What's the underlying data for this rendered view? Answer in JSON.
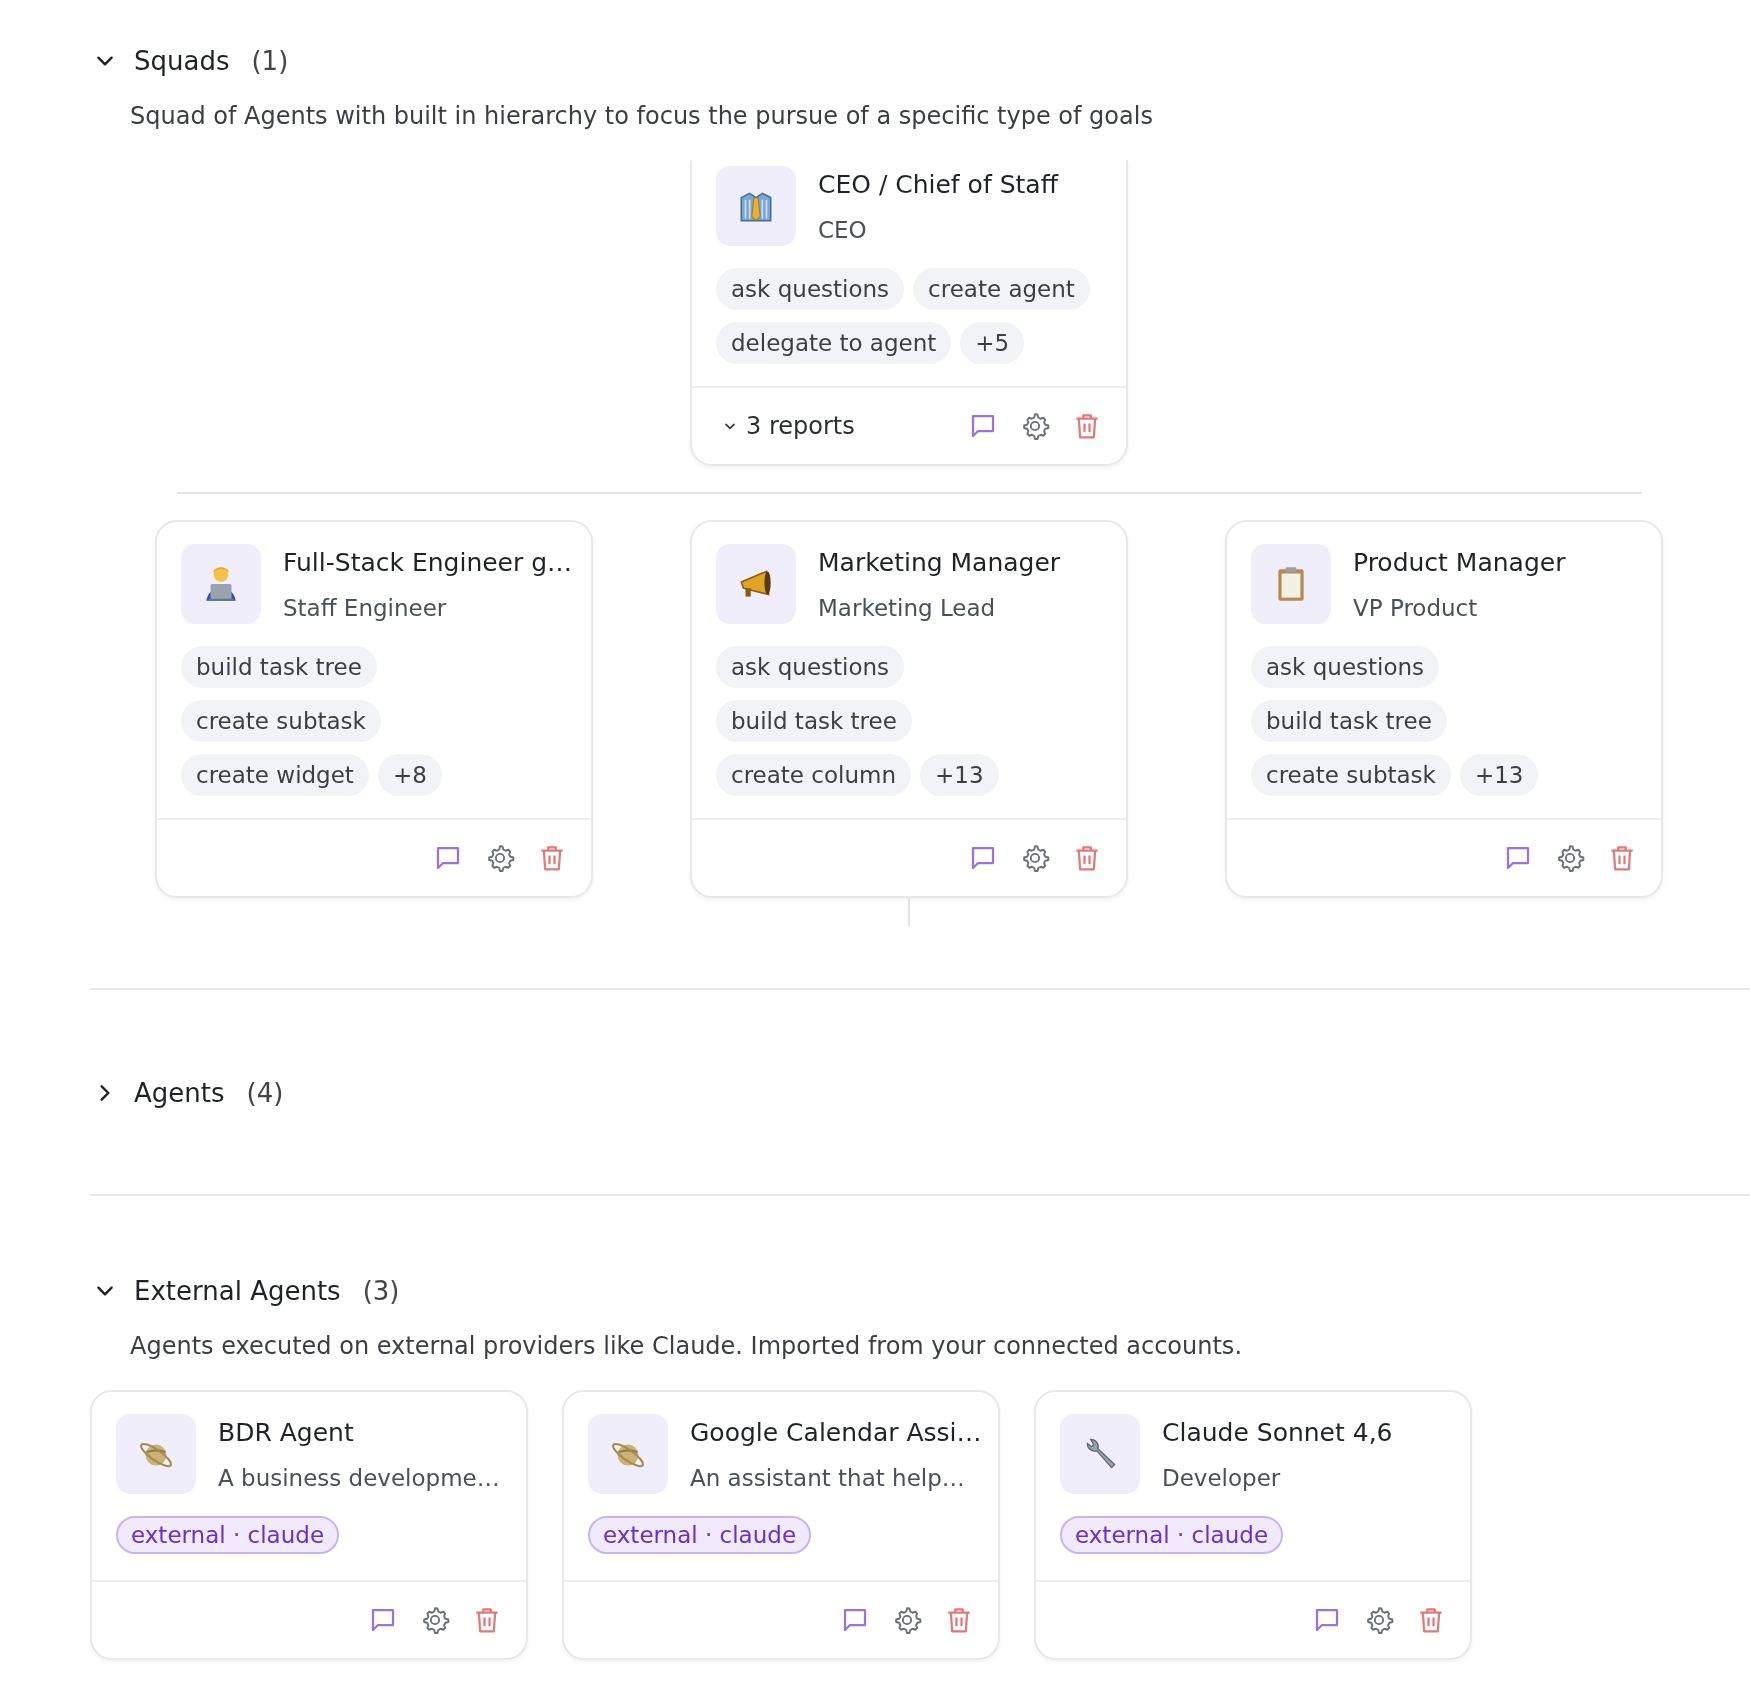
{
  "sections": [
    {
      "kind": "squad",
      "title": "Squads",
      "count": "(1)",
      "expanded": true,
      "description": "Squad of Agents with built in hierarchy to focus the pursue of a specific type of goals",
      "lead": {
        "name": "CEO / Chief of Staff",
        "role": "CEO",
        "tag_rows": [
          [
            "ask questions",
            "create agent"
          ],
          [
            "delegate to agent",
            "+5"
          ]
        ],
        "reports": "3 reports",
        "reports_expanded": true
      },
      "members": [
        {
          "name": "Full-Stack Engineer g…",
          "role": "Staff Engineer",
          "tag_rows": [
            [
              "build task tree"
            ],
            [
              "create subtask"
            ],
            [
              "create widget",
              "+8"
            ]
          ]
        },
        {
          "name": "Marketing Manager",
          "role": "Marketing Lead",
          "tag_rows": [
            [
              "ask questions"
            ],
            [
              "build task tree"
            ],
            [
              "create column",
              "+13"
            ]
          ]
        },
        {
          "name": "Product Manager",
          "role": "VP Product",
          "tag_rows": [
            [
              "ask questions"
            ],
            [
              "build task tree"
            ],
            [
              "create subtask",
              "+13"
            ]
          ]
        }
      ]
    },
    {
      "title": "Agents",
      "count": "(4)",
      "expanded": false
    },
    {
      "kind": "external",
      "title": "External Agents",
      "count": "(3)",
      "expanded": true,
      "description": "Agents executed on external providers like Claude. Imported from your connected accounts.",
      "cards": [
        {
          "name": "BDR Agent",
          "role": "A business developme…",
          "badge": "external · claude"
        },
        {
          "name": "Google Calendar Assi…",
          "role": "An assistant that help…",
          "badge": "external · claude"
        },
        {
          "name": "Claude Sonnet 4,6",
          "role": "Developer",
          "badge": "external · claude"
        }
      ]
    }
  ]
}
